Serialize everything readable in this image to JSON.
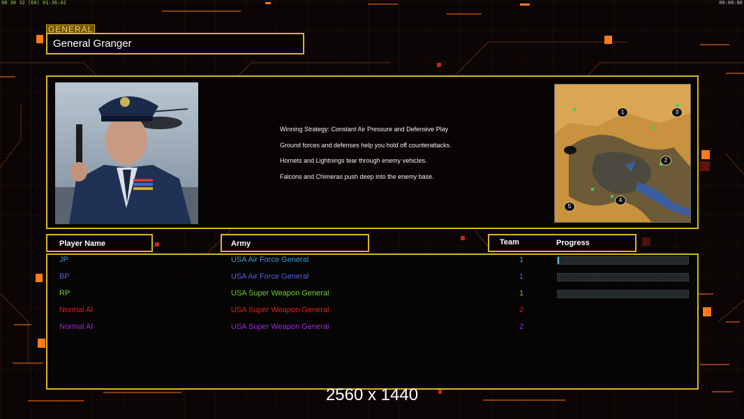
{
  "hud": {
    "top_left": "00 30 32 (60) 01:36:42",
    "top_right": "00:00:00"
  },
  "general": {
    "tag": "GENERAL",
    "name": "General Granger",
    "strategy": [
      "Winning Strategy: Constant Air Pressure and Defensive Play",
      "Ground forces and defenses help you hold off counterattacks.",
      "Hornets and Lightnings tear through enemy vehicles.",
      "Falcons and Chimeras push deep into the enemy base."
    ],
    "map_positions": [
      "1",
      "2",
      "3",
      "4",
      "5"
    ]
  },
  "table": {
    "headers": {
      "player": "Player Name",
      "army": "Army",
      "team": "Team",
      "progress": "Progress"
    },
    "rows": [
      {
        "name": "JP",
        "army": "USA Air Force General",
        "team": "1",
        "color": "#3a9bd6",
        "progress": 0.01
      },
      {
        "name": "BP",
        "army": "USA Air Force General",
        "team": "1",
        "color": "#4f63e0",
        "progress": 0
      },
      {
        "name": "RP",
        "army": "USA Super Weapon General",
        "team": "1",
        "color": "#6bd12a",
        "progress": 0
      },
      {
        "name": "Normal AI",
        "army": "USA Super Weapon General",
        "team": "2",
        "color": "#e02020",
        "progress": null
      },
      {
        "name": "Normal AI",
        "army": "USA Super Weapon General",
        "team": "2",
        "color": "#9b2bd6",
        "progress": null
      }
    ]
  },
  "resolution": "2560 x 1440",
  "colors": {
    "frame": "#d9b81f",
    "accent_orange": "#ff7a1a",
    "background": "#0b0505"
  }
}
